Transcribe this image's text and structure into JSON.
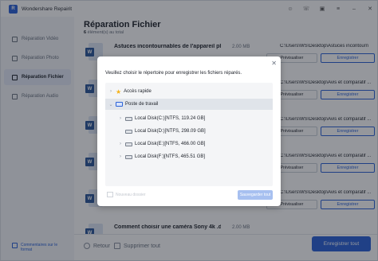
{
  "app": {
    "title": "Wondershare Repairit",
    "logo": "R"
  },
  "window_controls": [
    "person-icon",
    "headset-icon",
    "gift-icon",
    "menu-icon",
    "minimize-icon",
    "close-icon"
  ],
  "sidebar": {
    "items": [
      {
        "label": "Réparation Vidéo",
        "icon": "video-icon",
        "active": false
      },
      {
        "label": "Réparation Photo",
        "icon": "photo-icon",
        "active": false
      },
      {
        "label": "Réparation Fichier",
        "icon": "file-icon",
        "active": true
      },
      {
        "label": "Réparation Audio",
        "icon": "audio-icon",
        "active": false
      }
    ],
    "footer": "Commentaires sur le format"
  },
  "main": {
    "title": "Réparation Fichier",
    "count": "6",
    "count_suffix": " élément(s) au total",
    "files": [
      {
        "name": "Astuces incontournables de l'appareil pho...",
        "size": "2.00  MB",
        "path": "C:\\Users\\WS\\Desktop\\Astuces incontourn",
        "preview": "Prévisualiser",
        "save": "Enregistrer"
      },
      {
        "name": "",
        "size": "",
        "path": "C:\\Users\\WS\\Desktop\\Avis et comparatif ...",
        "preview": "Prévisualiser",
        "save": "Enregistrer"
      },
      {
        "name": "",
        "size": "",
        "path": "C:\\Users\\WS\\Desktop\\Avis et comparatif ...",
        "preview": "Prévisualiser",
        "save": "Enregistrer"
      },
      {
        "name": "",
        "size": "",
        "path": "C:\\Users\\WS\\Desktop\\Avis et comparatif ...",
        "preview": "Prévisualiser",
        "save": "Enregistrer"
      },
      {
        "name": "",
        "size": "",
        "path": "C:\\Users\\WS\\Desktop\\Avis et comparatif ...",
        "preview": "Prévisualiser",
        "save": "Enregistrer"
      },
      {
        "name": "Comment choisir une caméra Sony 4k .docx",
        "size": "2.00  MB",
        "path": "",
        "preview": "",
        "save": ""
      }
    ],
    "bottom": {
      "back": "Retour",
      "delete_all": "Supprimer tout",
      "save_all": "Enregistrer tout"
    }
  },
  "dialog": {
    "message": "Veuillez choisir le répertoire pour enregistrer les fichiers réparés.",
    "tree": [
      {
        "label": "Accès rapide",
        "icon": "star-icon",
        "expander": "›"
      },
      {
        "label": "Poste de travail",
        "icon": "computer-icon",
        "expander": "⌄",
        "selected": true
      },
      {
        "label": "Local Disk(C:)[NTFS, 119.24  GB]",
        "icon": "disk-icon",
        "expander": "›"
      },
      {
        "label": "Local Disk(D:)[NTFS, 298.09  GB]",
        "icon": "disk-icon",
        "expander": ""
      },
      {
        "label": "Local Disk(E:)[NTFS, 466.00  GB]",
        "icon": "disk-icon",
        "expander": "›"
      },
      {
        "label": "Local Disk(F:)[NTFS, 465.51  GB]",
        "icon": "disk-icon",
        "expander": "›"
      }
    ],
    "new_folder": "Nouveau dossier",
    "save": "Sauvegarder tout"
  }
}
